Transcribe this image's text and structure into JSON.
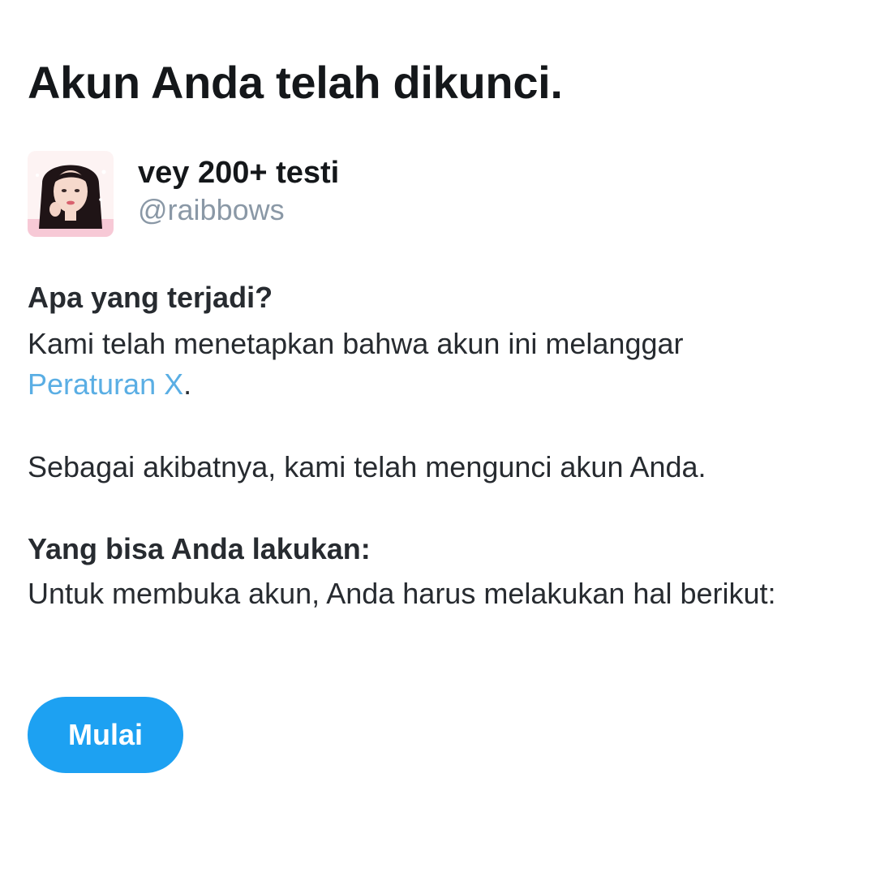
{
  "page": {
    "title": "Akun Anda telah dikunci."
  },
  "account": {
    "display_name": "vey 200+ testi",
    "handle": "@raibbows",
    "avatar_icon": "profile-photo-avatar"
  },
  "what_happened": {
    "heading": "Apa yang terjadi?",
    "line1": "Kami telah menetapkan bahwa akun ini melanggar",
    "link_text": "Peraturan X",
    "link_suffix": ".",
    "consequence": "Sebagai akibatnya, kami telah mengunci akun Anda."
  },
  "what_you_can_do": {
    "heading": "Yang bisa Anda lakukan:",
    "text": "Untuk membuka akun, Anda harus melakukan hal berikut:"
  },
  "actions": {
    "start_label": "Mulai"
  },
  "colors": {
    "primary_button": "#1da1f2",
    "link": "#5aaee4",
    "text": "#14171a",
    "secondary_text": "#8a98a6"
  }
}
